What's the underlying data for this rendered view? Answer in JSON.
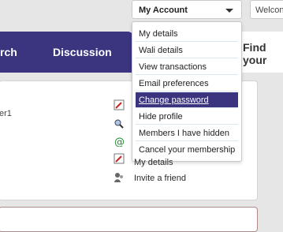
{
  "nav": {
    "search_partial": "rch",
    "discussion": "Discussion",
    "find_partial": "Find your"
  },
  "panel": {
    "user_partial": "er1"
  },
  "account": {
    "label": "My Account",
    "welcome_partial": "Welcon"
  },
  "menu": {
    "items": [
      {
        "label": "My details"
      },
      {
        "label": "Wali details"
      },
      {
        "label": "View transactions"
      },
      {
        "label": "Email preferences"
      },
      {
        "label": "Change password"
      },
      {
        "label": "Hide profile"
      },
      {
        "label": "Members I have hidden"
      },
      {
        "label": "Cancel your membership"
      }
    ]
  },
  "side": {
    "my_details_partial": "My details",
    "invite": "Invite a friend"
  },
  "colors": {
    "nav": "#3b3580",
    "selected": "#3b3580"
  }
}
